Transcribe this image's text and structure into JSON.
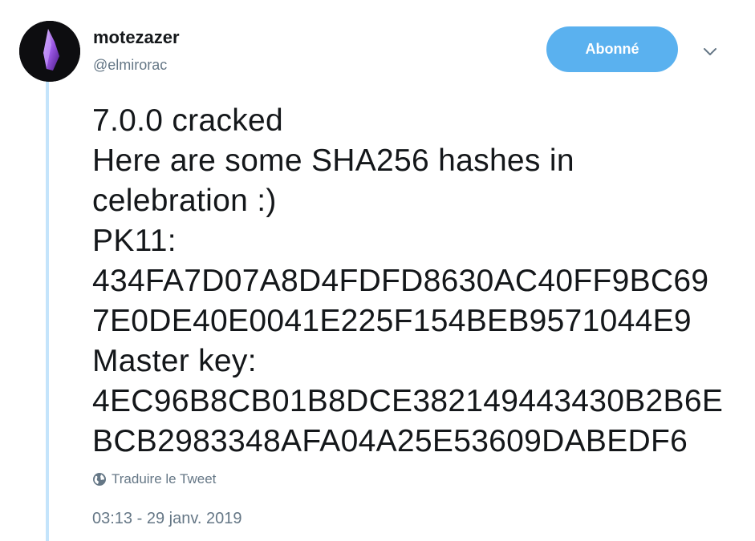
{
  "author": {
    "name": "motezazer",
    "handle": "@elmirorac"
  },
  "follow_button": {
    "label": "Abonné"
  },
  "tweet": {
    "lines": [
      "7.0.0 cracked",
      "Here are some SHA256 hashes in",
      "celebration :)",
      "PK11:",
      "434FA7D07A8D4FDFD8630AC40FF9BC69",
      "7E0DE40E0041E225F154BEB9571044E9",
      "Master key:",
      "4EC96B8CB01B8DCE382149443430B2B6E",
      "BCB2983348AFA04A25E53609DABEDF6"
    ]
  },
  "translate": {
    "label": "Traduire le Tweet",
    "icon": "globe-icon"
  },
  "timestamp": "03:13 - 29 janv. 2019",
  "colors": {
    "accent": "#5ab1ef",
    "thread_line": "#c4e4fb",
    "muted_text": "#657786",
    "text": "#14171a"
  }
}
